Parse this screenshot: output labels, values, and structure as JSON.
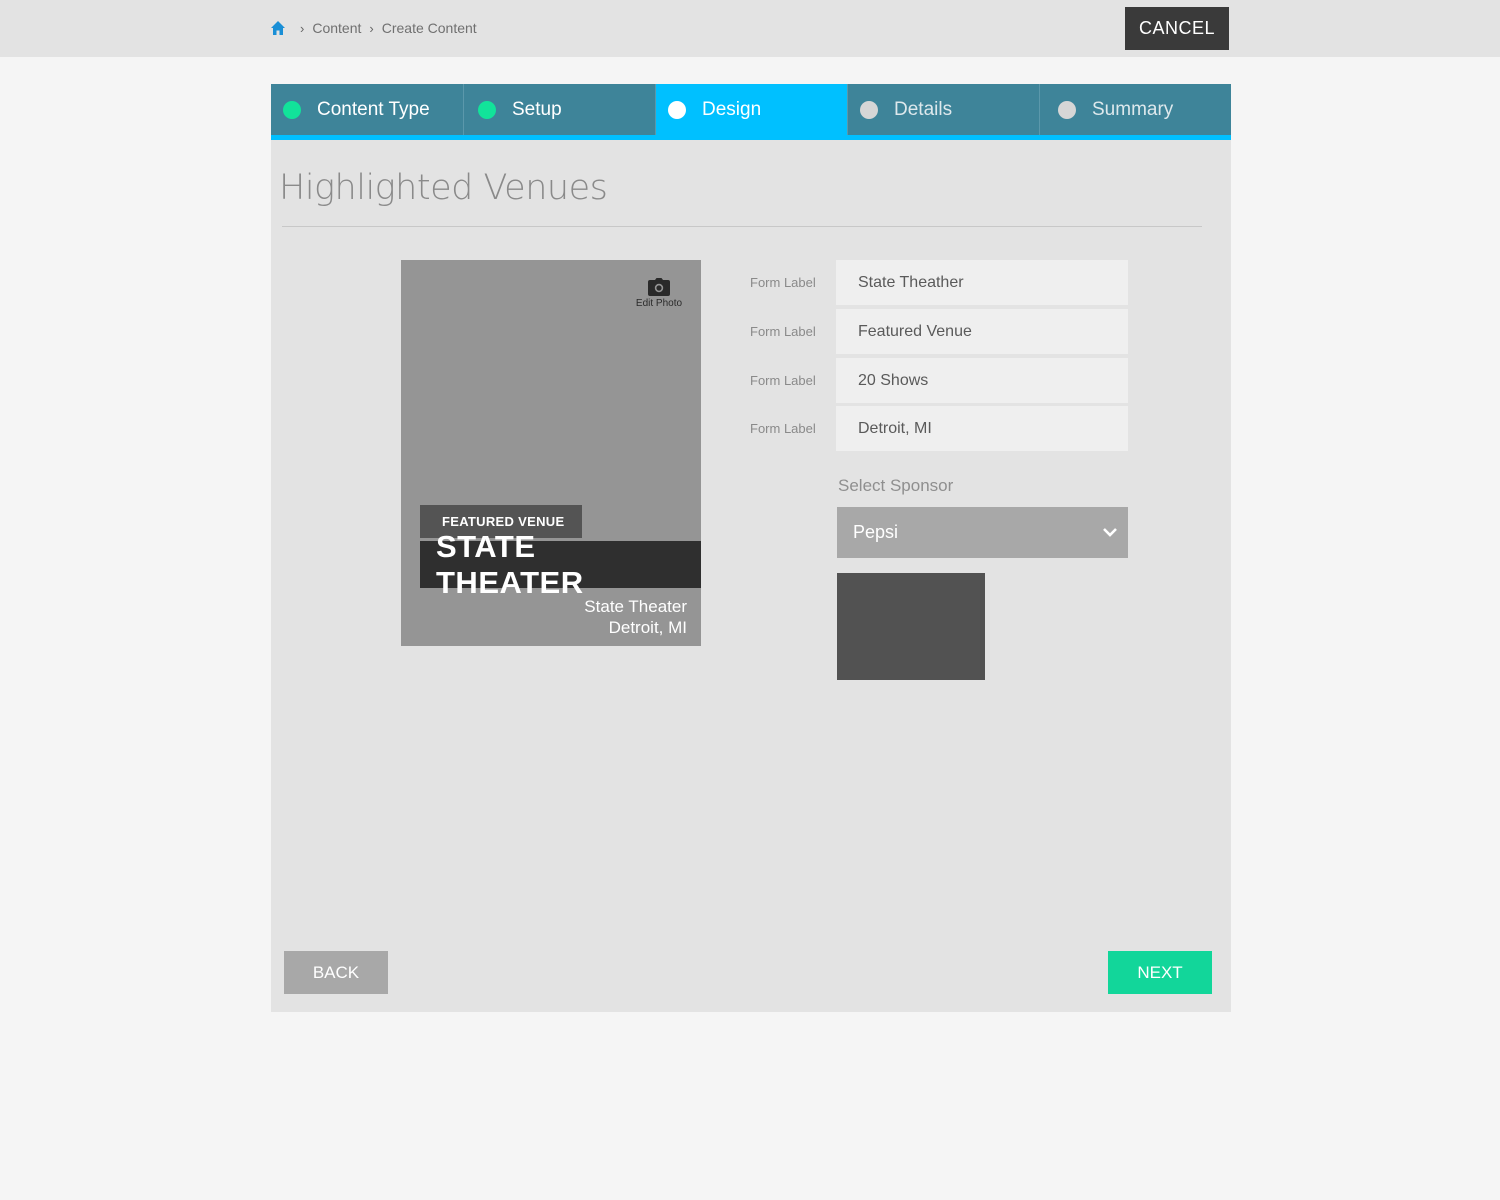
{
  "breadcrumb": {
    "home_icon": "home-icon",
    "items": [
      "Content",
      "Create Content"
    ]
  },
  "header": {
    "cancel_label": "CANCEL"
  },
  "steps": [
    {
      "label": "Content Type",
      "state": "done"
    },
    {
      "label": "Setup",
      "state": "done"
    },
    {
      "label": "Design",
      "state": "active"
    },
    {
      "label": "Details",
      "state": "pending"
    },
    {
      "label": "Summary",
      "state": "pending"
    }
  ],
  "page": {
    "title": "Highlighted Venues"
  },
  "preview": {
    "edit_photo_label": "Edit Photo",
    "edit_photo_icon": "camera-icon",
    "tag": "FEATURED VENUE",
    "name": "STATE THEATER",
    "subtitle_line1": "State Theater",
    "subtitle_line2": "Detroit, MI"
  },
  "form": {
    "fields": [
      {
        "label": "Form Label",
        "value": "State Theather"
      },
      {
        "label": "Form Label",
        "value": "Featured Venue"
      },
      {
        "label": "Form Label",
        "value": "20 Shows"
      },
      {
        "label": "Form Label",
        "value": "Detroit, MI"
      }
    ],
    "sponsor_label": "Select Sponsor",
    "sponsor_value": "Pepsi",
    "sponsor_icon": "chevron-down-icon"
  },
  "footer": {
    "back_label": "BACK",
    "next_label": "NEXT"
  },
  "colors": {
    "accent": "#00c0ff",
    "step_bar": "#3e8499",
    "done_dot": "#12e39a",
    "next": "#12d69a",
    "cancel": "#3a3a3a"
  }
}
